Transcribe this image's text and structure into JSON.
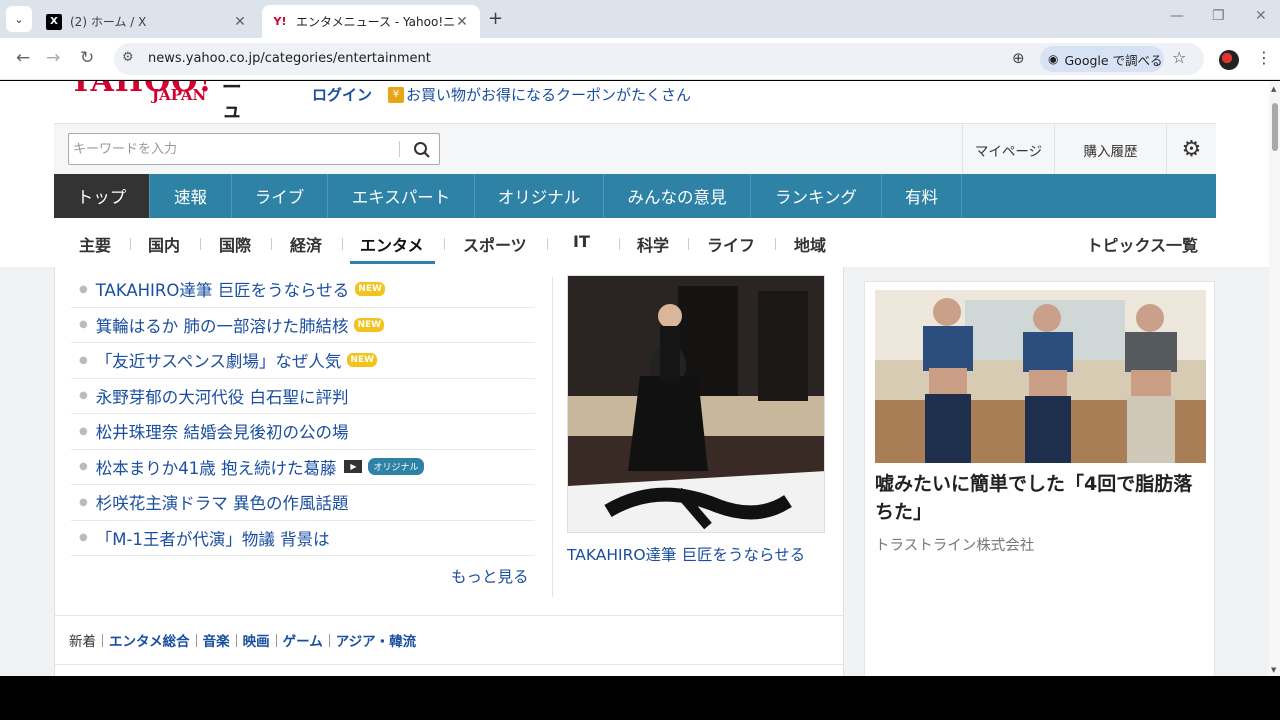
{
  "browser": {
    "tabs": [
      {
        "title": "(2) ホーム / X",
        "favicon": "x-logo-icon",
        "active": false
      },
      {
        "title": "エンタメニュース - Yahoo!ニュース",
        "favicon": "yahoo-icon",
        "active": true
      }
    ],
    "url": "news.yahoo.co.jp/categories/entertainment",
    "lens_label": "Google で調べる"
  },
  "header": {
    "logo_text": "YAHOO!",
    "logo_sub": "JAPAN",
    "logo_news": "ニュース",
    "login": "ログイン",
    "coupon": "お買い物がお得になるクーポンがたくさん"
  },
  "search": {
    "placeholder": "キーワードを入力",
    "mypage": "マイページ",
    "history": "購入履歴"
  },
  "main_nav": {
    "items": [
      "トップ",
      "速報",
      "ライブ",
      "エキスパート",
      "オリジナル",
      "みんなの意見",
      "ランキング",
      "有料"
    ]
  },
  "sub_nav": {
    "categories": [
      "主要",
      "国内",
      "国際",
      "経済",
      "エンタメ",
      "スポーツ",
      "IT",
      "科学",
      "ライフ",
      "地域"
    ],
    "active": "エンタメ",
    "topics_all": "トピックス一覧"
  },
  "topics": [
    {
      "text": "TAKAHIRO達筆 巨匠をうならせる",
      "badge": "NEW"
    },
    {
      "text": "箕輪はるか 肺の一部溶けた肺結核",
      "badge": "NEW"
    },
    {
      "text": "「友近サスペンス劇場」なぜ人気",
      "badge": "NEW"
    },
    {
      "text": "永野芽郁の大河代役 白石聖に評判",
      "badge": ""
    },
    {
      "text": "松井珠理奈 結婚会見後初の公の場",
      "badge": ""
    },
    {
      "text": "松本まりか41歳 抱え続けた葛藤",
      "badge": "オリジナル"
    },
    {
      "text": "杉咲花主演ドラマ 異色の作風話題",
      "badge": ""
    },
    {
      "text": "「M-1王者が代演」物議 背景は",
      "badge": ""
    }
  ],
  "more": "もっと見る",
  "pickup": {
    "caption": "TAKAHIRO達筆 巨匠をうならせる"
  },
  "genres": [
    "新着",
    "エンタメ総合",
    "音楽",
    "映画",
    "ゲーム",
    "アジア・韓流"
  ],
  "ad": {
    "title": "嘘みたいに簡単でした「4回で脂肪落ちた」",
    "sponsor": "トラストライン株式会社"
  },
  "colors": {
    "nav_blue": "#2e82a5",
    "link_blue": "#1a4ea1",
    "yahoo_red": "#d1002f",
    "new_badge": "#f3c21b"
  }
}
